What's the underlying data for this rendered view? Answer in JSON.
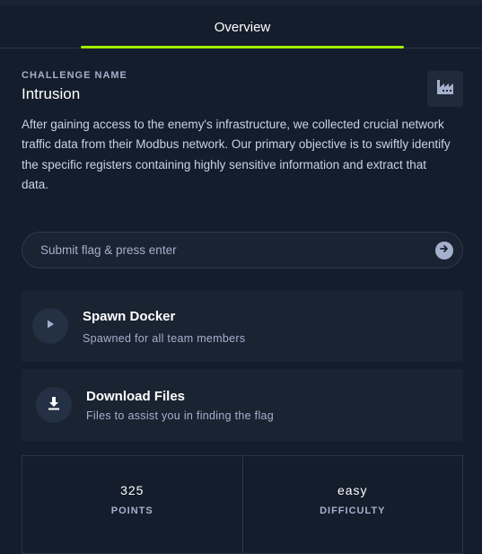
{
  "tabs": [
    {
      "label": "Overview",
      "active": true
    }
  ],
  "challenge": {
    "eyebrow": "CHALLENGE NAME",
    "name": "Intrusion",
    "category_icon": "factory-icon",
    "description": "After gaining access to the enemy's infrastructure, we collected crucial network traffic data from their Modbus network. Our primary objective is to swiftly identify the specific registers containing highly sensitive information and extract that data."
  },
  "flag_input": {
    "placeholder": "Submit flag & press enter",
    "value": "",
    "submit_icon": "arrow-right-circle-icon"
  },
  "spawn_card": {
    "title": "Spawn Docker",
    "subtitle": "Spawned for all team members",
    "icon": "play-icon"
  },
  "download_card": {
    "title": "Download Files",
    "subtitle": "Files to assist you in finding the flag",
    "icon": "download-icon"
  },
  "stats": [
    {
      "value": "325",
      "label": "POINTS"
    },
    {
      "value": "easy",
      "label": "DIFFICULTY"
    }
  ],
  "colors": {
    "background": "#141d2b",
    "card": "#1a2332",
    "accent": "#9fef00",
    "muted_text": "#a4b1cd"
  }
}
